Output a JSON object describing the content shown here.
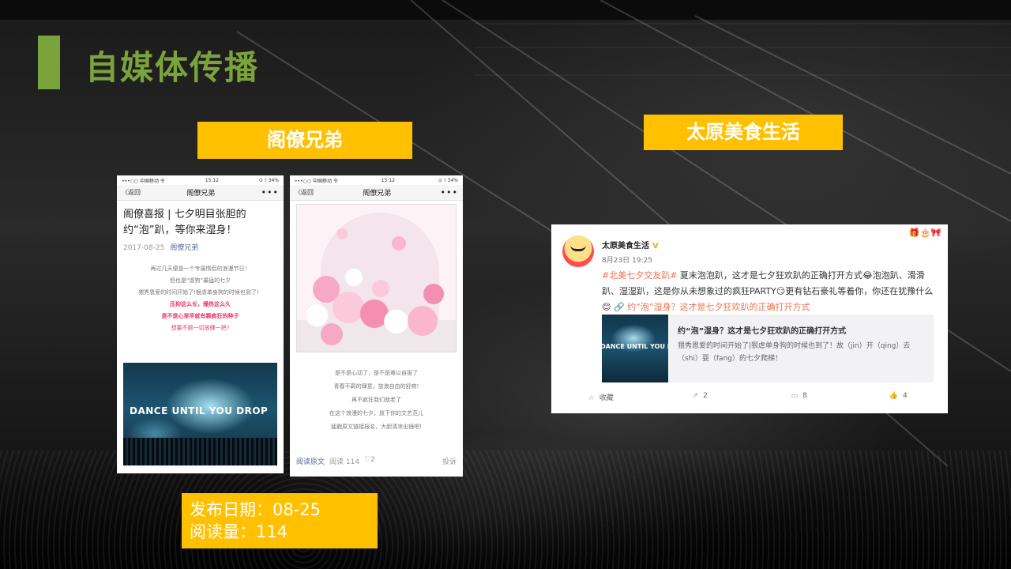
{
  "slide": {
    "title": "自媒体传播"
  },
  "labels": {
    "left": "阁僚兄弟",
    "right": "太原美食生活"
  },
  "info": {
    "date": "发布日期：08-25",
    "reads": "阅读量：114"
  },
  "phone1": {
    "carrier": "•••○○ 中国移动 令",
    "time": "15:12",
    "battery": "⊙ ⁊ 34%",
    "back": "〈返回",
    "nav_title": "阁僚兄弟",
    "menu": "•••",
    "article_title": "阁僚喜报 | 七夕明目张胆的约“泡”趴，等你来湿身！",
    "date": "2017-08-25",
    "source": "阁僚兄弟",
    "lines": [
      "再过几天便是一个专属情侣的浪漫节日！",
      "但也是“虐狗”最猛的七夕",
      "猥秀恩爱的时间开始了!狠虐单身狗的时候也到了！",
      "压抑这么长，燥热这么久",
      "是不是心里早就有颗疯狂的种子",
      "想要不顾一切放肆一把?"
    ],
    "image_text": "DANCE UNTIL YOU DROP"
  },
  "phone2": {
    "carrier": "•••○○ 中国移动 令",
    "time": "15:12",
    "battery": "⊙ ⁊ 34%",
    "back": "〈返回",
    "nav_title": "阁僚兄弟",
    "menu": "•••",
    "lines": [
      "是不是心动了，是不是难以自拔了",
      "青春不羁的肆意，放浪自由的舒爽!",
      "再不疯狂我们就老了",
      "在这个浪漫的七夕，放下你的文艺范儿",
      "猛戳原文链接报名，大胆清凉出镜吧!"
    ],
    "footer_link": "阅读原文",
    "footer_reads": "阅读 114",
    "footer_likes": "♡2",
    "footer_report": "投诉"
  },
  "weibo": {
    "name": "太原美食生活",
    "verified": "V",
    "time": "8月23日 19:25",
    "deco": "🎁🎂🎀",
    "tag": "#北美七夕交友趴#",
    "text_1": " 夏末泡泡趴，这才是七夕狂欢趴的正确打开方式",
    "emoji": "😂",
    "text_2": "泡泡趴、滑滑趴、湿湿趴，这是你从未想象过的疯狂PARTY",
    "emoji2": "😏",
    "text_3": "更有钻石豪礼等着你，你还在犹豫什么",
    "emoji3": "😊",
    "link": " 🔗 约“泡”湿身？这才是七夕狂欢趴的正确打开方式",
    "share_image_text": "DANCE UNTIL YOU D",
    "share_title": "约“泡”湿身？这才是七夕狂欢趴的正确打开方式",
    "share_desc": "猥秀恩爱的时间开始了|狠虐单身狗的时候也到了！故（jin）开（qing）去（shi）耍（fang）的七夕爬梯！",
    "actions": [
      {
        "icon": "☆",
        "label": "收藏"
      },
      {
        "icon": "↗",
        "label": "2"
      },
      {
        "icon": "▭",
        "label": "8"
      },
      {
        "icon": "👍",
        "label": "4"
      }
    ]
  }
}
